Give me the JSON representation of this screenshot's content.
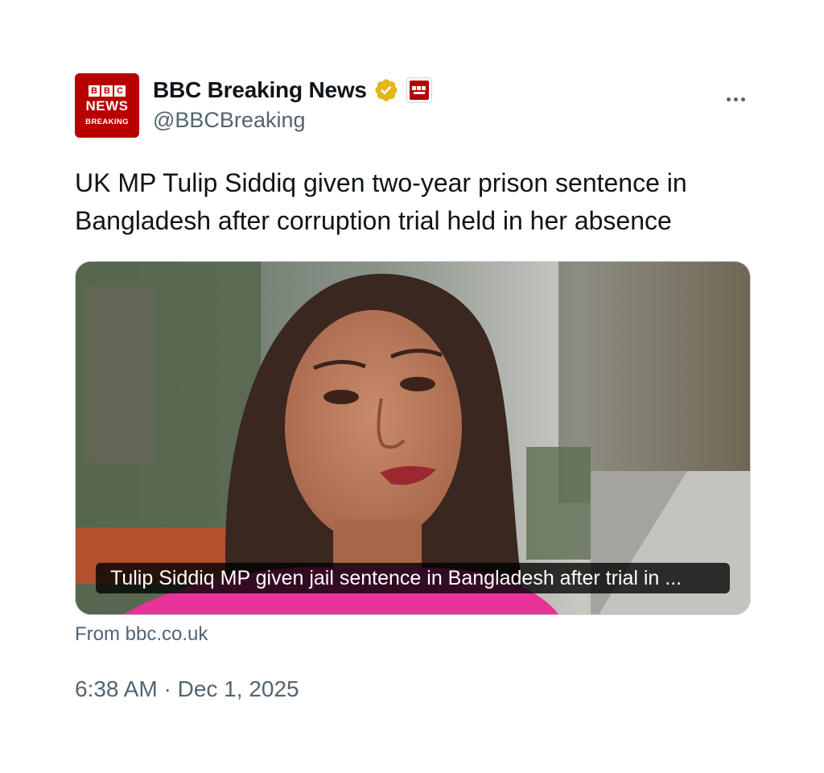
{
  "account": {
    "avatar": {
      "letters": [
        "B",
        "B",
        "C"
      ],
      "news": "NEWS",
      "breaking": "BREAKING",
      "bg_color": "#b80000"
    },
    "display_name": "BBC Breaking News",
    "handle": "@BBCBreaking",
    "verified_icon": "gold-verified-badge-icon",
    "affiliation_icon": "bbc-news-affiliate-badge-icon"
  },
  "more_icon": "more-options-icon",
  "tweet": {
    "text": "UK MP Tulip Siddiq given two-year prison sentence in Bangladesh after corruption trial held in her absence"
  },
  "card": {
    "caption": "Tulip Siddiq MP given jail sentence in Bangladesh after trial in ...",
    "source": "From bbc.co.uk"
  },
  "timestamp": "6:38 AM · Dec 1, 2025",
  "colors": {
    "text_primary": "#0f1419",
    "text_secondary": "#536471",
    "verified_gold": "#e2b719",
    "bbc_red": "#b80000"
  }
}
